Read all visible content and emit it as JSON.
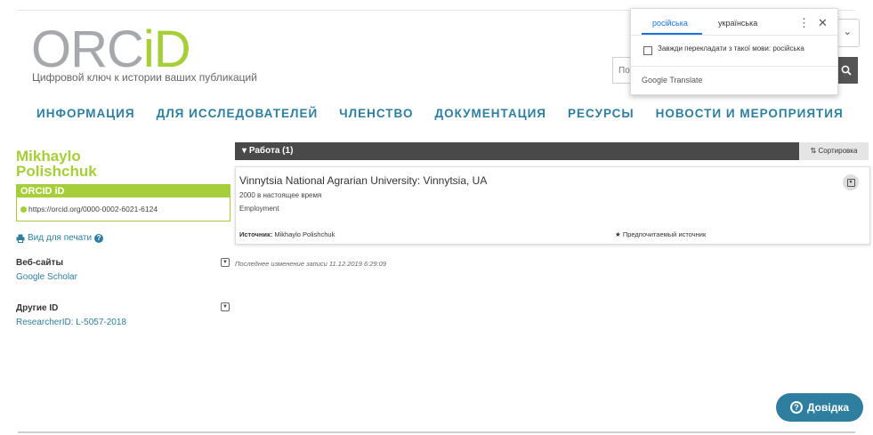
{
  "header": {
    "logo": {
      "orc": "ORC",
      "id": "iD"
    },
    "tagline": "Цифровой ключ к истории ваших публикаций",
    "search_placeholder": "Пои"
  },
  "translate_popup": {
    "tab_source": "російська",
    "tab_target": "українська",
    "checkbox_label": "Завжди перекладати з такої мови: російська",
    "brand": "Google Translate"
  },
  "nav": {
    "items": [
      "ИНФОРМАЦИЯ",
      "ДЛЯ ИССЛЕДОВАТЕЛЕЙ",
      "ЧЛЕНСТВО",
      "ДОКУМЕНТАЦИЯ",
      "РЕСУРСЫ",
      "НОВОСТИ И МЕРОПРИЯТИЯ"
    ]
  },
  "profile": {
    "first_name": "Mikhaylo",
    "last_name": "Polishchuk",
    "orcid_label": "ORCID iD",
    "orcid_url": "https://orcid.org/0000-0002-6021-6124",
    "print_view": "Вид для печати",
    "websites_title": "Веб-сайты",
    "websites_link": "Google Scholar",
    "other_ids_title": "Другие ID",
    "other_ids_link": "ResearcherID: L-5057-2018",
    "last_modified": "Последнее изменение записи 11.12.2019 6:29:09"
  },
  "works": {
    "header": "Работа (1)",
    "sort_label": "Сортировка",
    "item": {
      "title": "Vinnytsia National Agrarian University: Vinnytsia, UA",
      "date": "2000 в настоящее время",
      "type": "Employment",
      "source_label": "Источник:",
      "source_value": "Mikhaylo Polishchuk",
      "preferred": "Предпочитаемый источник"
    }
  },
  "help_button": {
    "label": "Довідка"
  }
}
